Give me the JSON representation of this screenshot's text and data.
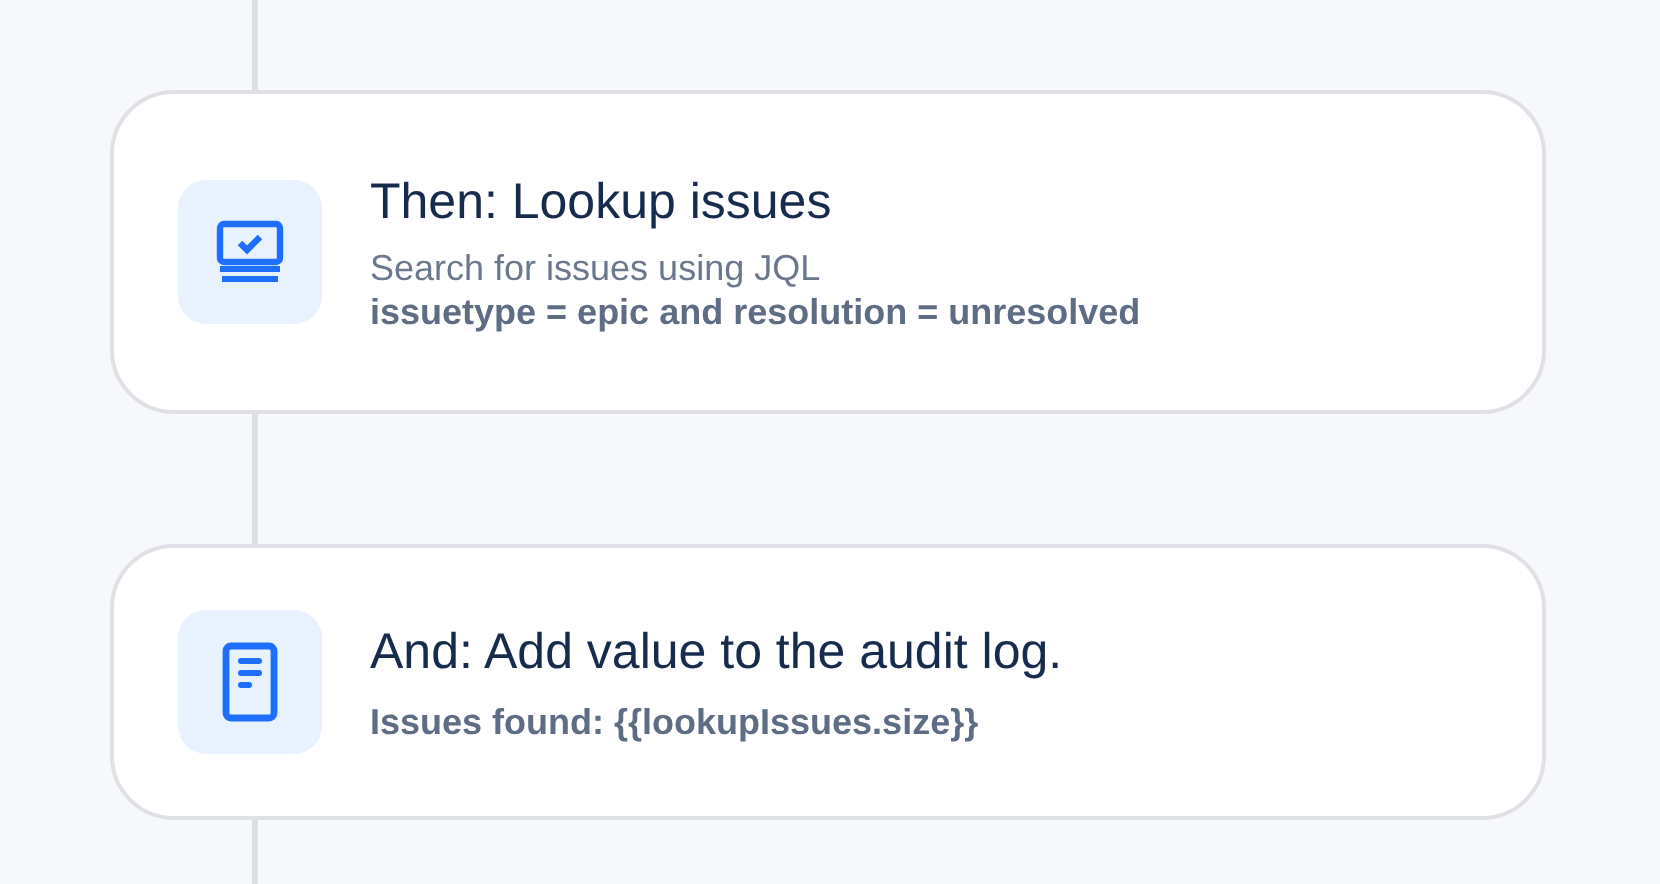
{
  "steps": [
    {
      "kind": "lookup",
      "title": "Then: Lookup issues",
      "description": "Search for issues using JQL",
      "detail": "issuetype = epic and resolution = unresolved"
    },
    {
      "kind": "log",
      "title": "And: Add value to the audit log.",
      "detail": "Issues found: {{lookupIssues.size}}"
    }
  ]
}
